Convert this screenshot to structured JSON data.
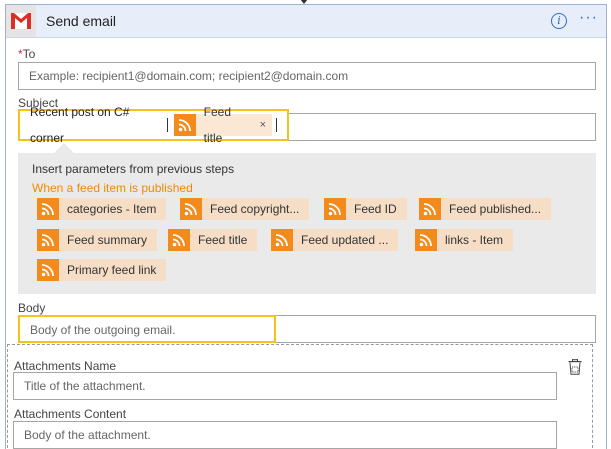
{
  "header": {
    "title": "Send email"
  },
  "to": {
    "required_mark": "*",
    "label": "To",
    "placeholder": "Example: recipient1@domain.com; recipient2@domain.com"
  },
  "subject": {
    "label": "Subject",
    "text": "Recent post on C# corner",
    "token": "Feed title",
    "token_close": "×"
  },
  "params": {
    "title": "Insert parameters from previous steps",
    "source": "When a feed item is published",
    "items": [
      "categories - Item",
      "Feed copyright...",
      "Feed ID",
      "Feed published...",
      "Feed summary",
      "Feed title",
      "Feed updated ...",
      "links - Item",
      "Primary feed link"
    ]
  },
  "body": {
    "label": "Body",
    "placeholder": "Body of the outgoing email."
  },
  "attachments": {
    "name_label": "Attachments Name",
    "name_placeholder": "Title of the attachment.",
    "content_label": "Attachments Content",
    "content_placeholder": "Body of the attachment."
  },
  "colors": {
    "accent": "#2b6cd6",
    "highlight": "#f3c21b",
    "rss": "#f28b1c",
    "source": "#f08a00"
  },
  "icons": [
    "gmail-icon",
    "info-icon",
    "more-icon",
    "rss-icon",
    "delete-icon"
  ]
}
